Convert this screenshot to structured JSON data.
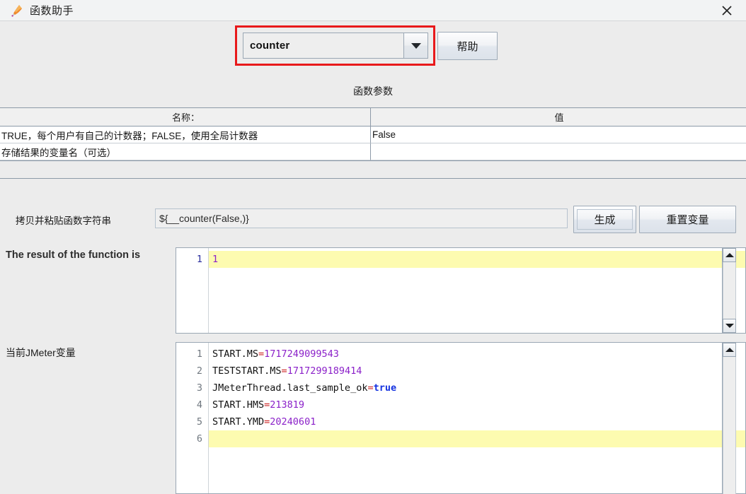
{
  "window": {
    "title": "函数助手",
    "icon": "feather-pen-icon",
    "close_label": "×"
  },
  "toolbar": {
    "function_select": {
      "value": "counter",
      "arrow_icon": "chevron-down-icon",
      "highlighted": true,
      "highlight_color": "#e8191b"
    },
    "help_label": "帮助"
  },
  "params": {
    "section_title": "函数参数",
    "columns": [
      "名称：",
      "值"
    ],
    "rows": [
      {
        "name": "TRUE，每个用户有自己的计数器；FALSE，使用全局计数器",
        "value": "False"
      },
      {
        "name": "存储结果的变量名（可选）",
        "value": ""
      }
    ]
  },
  "function_string": {
    "label": "拷贝并粘贴函数字符串",
    "value": "${__counter(False,)}",
    "generate_label": "生成",
    "reset_label": "重置变量"
  },
  "result_panel": {
    "label": "The result of the function is",
    "lines": [
      {
        "number": "1",
        "text": "1",
        "highlighted": true,
        "token": "num"
      }
    ],
    "line_numbers": [
      "1"
    ]
  },
  "variables_panel": {
    "label": "当前JMeter变量",
    "line_numbers": [
      "1",
      "2",
      "3",
      "4",
      "5",
      "6"
    ],
    "lines": [
      {
        "number": "1",
        "key": "START.MS",
        "eq": "=",
        "value": "1717249099543",
        "type": "num",
        "highlighted": false
      },
      {
        "number": "2",
        "key": "TESTSTART.MS",
        "eq": "=",
        "value": "1717299189414",
        "type": "num",
        "highlighted": false
      },
      {
        "number": "3",
        "key": "JMeterThread.last_sample_ok",
        "eq": "=",
        "value": "true",
        "type": "bool",
        "highlighted": false
      },
      {
        "number": "4",
        "key": "START.HMS",
        "eq": "=",
        "value": "213819",
        "type": "num",
        "highlighted": false
      },
      {
        "number": "5",
        "key": "START.YMD",
        "eq": "=",
        "value": "20240601",
        "type": "num",
        "highlighted": false
      },
      {
        "number": "6",
        "key": "",
        "eq": "",
        "value": "",
        "type": "none",
        "highlighted": true
      }
    ]
  },
  "scrollbars": {
    "up_icon": "triangle-up-icon",
    "down_icon": "triangle-down-icon"
  },
  "colors": {
    "highlight_line": "#fdfbb0",
    "value_purple": "#8b21c9",
    "bool_blue": "#1432e0",
    "equals_red": "#cc2222",
    "gutter_blue": "#2b2f9e",
    "gutter_gray": "#707880"
  }
}
